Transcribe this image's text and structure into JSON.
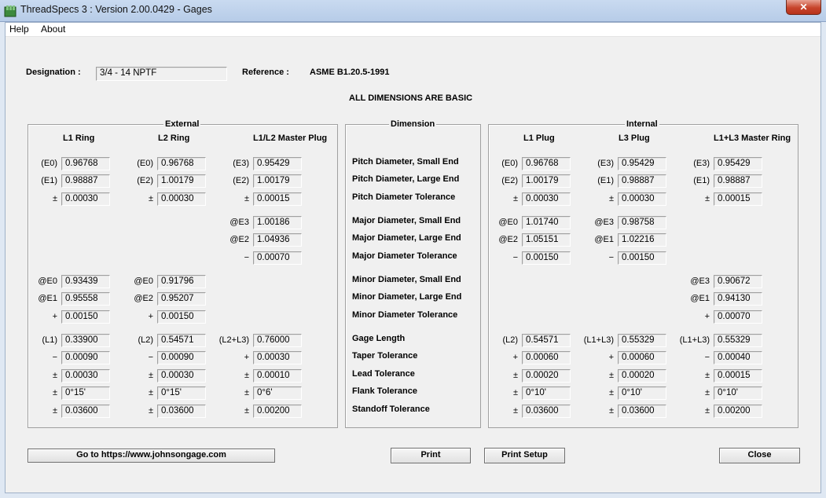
{
  "titlebar": {
    "title": "ThreadSpecs 3 : Version 2.00.0429 - Gages",
    "close": "✕"
  },
  "menu": [
    "Help",
    "About"
  ],
  "header": {
    "designation_label": "Designation :",
    "designation_value": "3/4 - 14 NPTF",
    "reference_label": "Reference :",
    "reference_value": "ASME B1.20.5-1991",
    "basic_note": "ALL DIMENSIONS ARE BASIC"
  },
  "external": {
    "title": "External",
    "col_headers": [
      "L1 Ring",
      "L2 Ring",
      "L1/L2 Master Plug"
    ],
    "columns": [
      [
        {
          "p": "(E0)",
          "v": "0.96768"
        },
        {
          "p": "(E1)",
          "v": "0.98887"
        },
        {
          "p": "±",
          "v": "0.00030"
        },
        null,
        null,
        null,
        {
          "p": "@E0",
          "v": "0.93439"
        },
        {
          "p": "@E1",
          "v": "0.95558"
        },
        {
          "p": "+",
          "v": "0.00150"
        },
        {
          "p": "(L1)",
          "v": "0.33900"
        },
        {
          "p": "−",
          "v": "0.00090"
        },
        {
          "p": "±",
          "v": "0.00030"
        },
        {
          "p": "±",
          "v": "0°15'"
        },
        {
          "p": "±",
          "v": "0.03600"
        }
      ],
      [
        {
          "p": "(E0)",
          "v": "0.96768"
        },
        {
          "p": "(E2)",
          "v": "1.00179"
        },
        {
          "p": "±",
          "v": "0.00030"
        },
        null,
        null,
        null,
        {
          "p": "@E0",
          "v": "0.91796"
        },
        {
          "p": "@E2",
          "v": "0.95207"
        },
        {
          "p": "+",
          "v": "0.00150"
        },
        {
          "p": "(L2)",
          "v": "0.54571"
        },
        {
          "p": "−",
          "v": "0.00090"
        },
        {
          "p": "±",
          "v": "0.00030"
        },
        {
          "p": "±",
          "v": "0°15'"
        },
        {
          "p": "±",
          "v": "0.03600"
        }
      ],
      [
        {
          "p": "(E3)",
          "v": "0.95429"
        },
        {
          "p": "(E2)",
          "v": "1.00179"
        },
        {
          "p": "±",
          "v": "0.00015"
        },
        {
          "p": "@E3",
          "v": "1.00186"
        },
        {
          "p": "@E2",
          "v": "1.04936"
        },
        {
          "p": "−",
          "v": "0.00070"
        },
        null,
        null,
        null,
        {
          "p": "(L2+L3)",
          "v": "0.76000"
        },
        {
          "p": "+",
          "v": "0.00030"
        },
        {
          "p": "±",
          "v": "0.00010"
        },
        {
          "p": "±",
          "v": "0°6'"
        },
        {
          "p": "±",
          "v": "0.00200"
        }
      ]
    ]
  },
  "dimension": {
    "title": "Dimension",
    "rows": [
      "Pitch Diameter, Small End",
      "Pitch Diameter, Large End",
      "Pitch Diameter Tolerance",
      "Major Diameter, Small End",
      "Major Diameter, Large End",
      "Major Diameter Tolerance",
      "Minor Diameter, Small End",
      "Minor Diameter, Large End",
      "Minor Diameter Tolerance",
      "Gage Length",
      "Taper Tolerance",
      "Lead Tolerance",
      "Flank Tolerance",
      "Standoff Tolerance"
    ]
  },
  "internal": {
    "title": "Internal",
    "col_headers": [
      "L1 Plug",
      "L3 Plug",
      "L1+L3 Master Ring"
    ],
    "columns": [
      [
        {
          "p": "(E0)",
          "v": "0.96768"
        },
        {
          "p": "(E2)",
          "v": "1.00179"
        },
        {
          "p": "±",
          "v": "0.00030"
        },
        {
          "p": "@E0",
          "v": "1.01740"
        },
        {
          "p": "@E2",
          "v": "1.05151"
        },
        {
          "p": "−",
          "v": "0.00150"
        },
        null,
        null,
        null,
        {
          "p": "(L2)",
          "v": "0.54571"
        },
        {
          "p": "+",
          "v": "0.00060"
        },
        {
          "p": "±",
          "v": "0.00020"
        },
        {
          "p": "±",
          "v": "0°10'"
        },
        {
          "p": "±",
          "v": "0.03600"
        }
      ],
      [
        {
          "p": "(E3)",
          "v": "0.95429"
        },
        {
          "p": "(E1)",
          "v": "0.98887"
        },
        {
          "p": "±",
          "v": "0.00030"
        },
        {
          "p": "@E3",
          "v": "0.98758"
        },
        {
          "p": "@E1",
          "v": "1.02216"
        },
        {
          "p": "−",
          "v": "0.00150"
        },
        null,
        null,
        null,
        {
          "p": "(L1+L3)",
          "v": "0.55329"
        },
        {
          "p": "+",
          "v": "0.00060"
        },
        {
          "p": "±",
          "v": "0.00020"
        },
        {
          "p": "±",
          "v": "0°10'"
        },
        {
          "p": "±",
          "v": "0.03600"
        }
      ],
      [
        {
          "p": "(E3)",
          "v": "0.95429"
        },
        {
          "p": "(E1)",
          "v": "0.98887"
        },
        {
          "p": "±",
          "v": "0.00015"
        },
        null,
        null,
        null,
        {
          "p": "@E3",
          "v": "0.90672"
        },
        {
          "p": "@E1",
          "v": "0.94130"
        },
        {
          "p": "+",
          "v": "0.00070"
        },
        {
          "p": "(L1+L3)",
          "v": "0.55329"
        },
        {
          "p": "−",
          "v": "0.00040"
        },
        {
          "p": "±",
          "v": "0.00015"
        },
        {
          "p": "±",
          "v": "0°10'"
        },
        {
          "p": "±",
          "v": "0.00200"
        }
      ]
    ]
  },
  "buttons": {
    "website": "Go to https://www.johnsongage.com",
    "print": "Print",
    "print_setup": "Print Setup",
    "close": "Close"
  }
}
